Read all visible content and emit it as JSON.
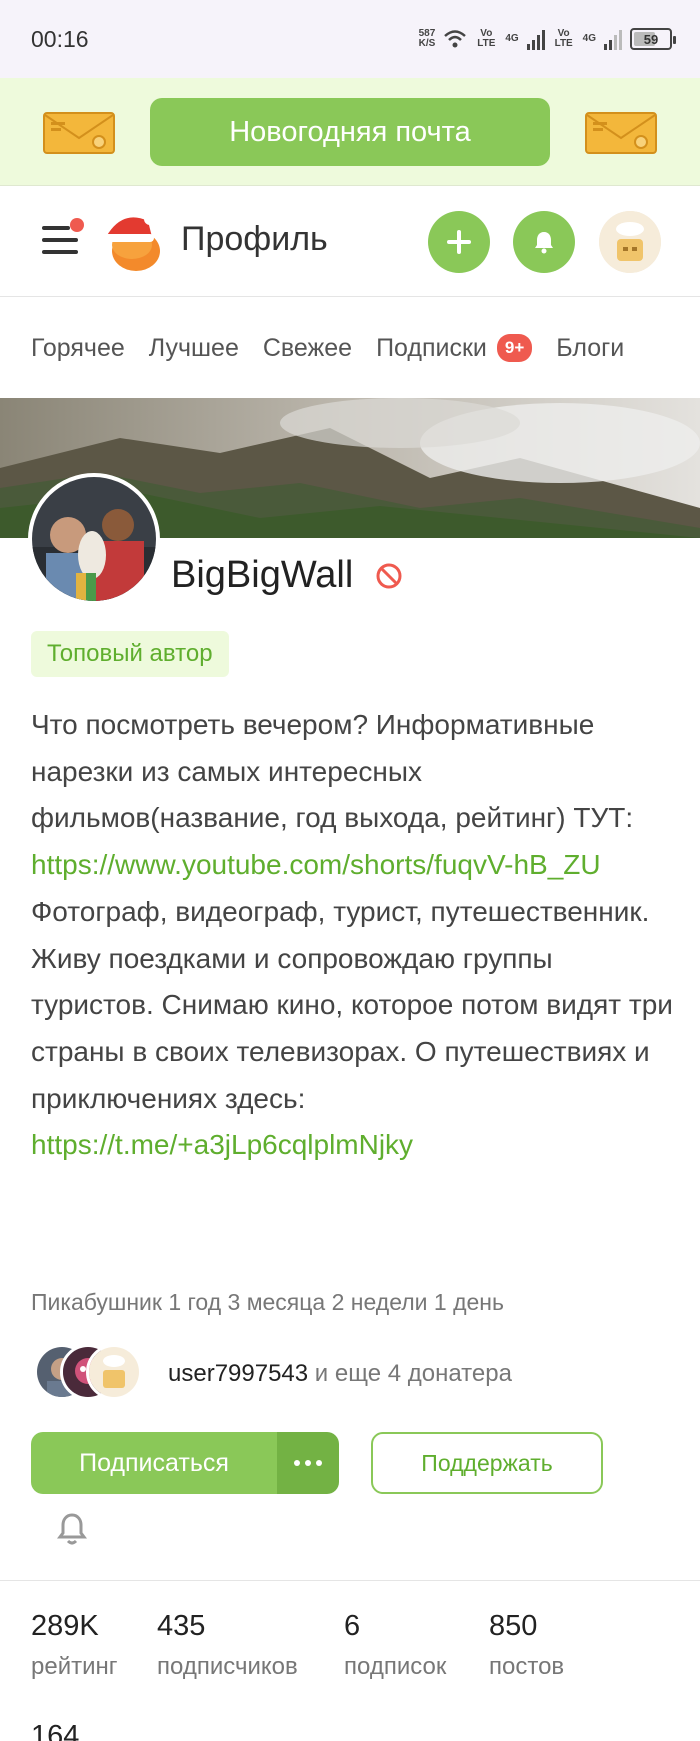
{
  "status_bar": {
    "time": "00:16",
    "net_speed": "587",
    "net_unit": "K/S",
    "volte1": "Vo LTE",
    "sig1": "4G",
    "volte2": "Vo LTE",
    "sig2": "4G",
    "battery": "59"
  },
  "promo": {
    "button_label": "Новогодняя почта",
    "icon_left": "envelope-icon",
    "icon_right": "envelope-icon"
  },
  "header": {
    "title": "Профиль",
    "menu_icon": "menu-icon",
    "add_icon": "plus-icon",
    "bell_icon": "bell-icon"
  },
  "tabs": [
    {
      "label": "Горячее"
    },
    {
      "label": "Лучшее"
    },
    {
      "label": "Свежее"
    },
    {
      "label": "Подписки",
      "badge": "9+"
    },
    {
      "label": "Блоги"
    }
  ],
  "profile": {
    "username": "BigBigWall",
    "tag": "Топовый автор",
    "bio_line1": "Что посмотреть вечером? Информативные нарезки из самых интересных фильмов(название, год выхода, рейтинг) ТУТ: ",
    "bio_link1": "https://www.youtube.com/shorts/fuqvV-hB_ZU",
    "bio_line2": "Фотограф, видеограф, турист, путешественник. Живу поездками и сопровождаю группы туристов. Снимаю кино, которое потом видят три страны в своих телевизорах. О путешествиях и приключениях здесь: ",
    "bio_link2": "https://t.me/+a3jLp6cqlplmNjky",
    "since": "Пикабушник 1 год 3 месяца 2 недели 1 день"
  },
  "donors": {
    "user": "user7997543",
    "rest": " и еще 4 донатера"
  },
  "actions": {
    "subscribe": "Подписаться",
    "support": "Поддержать"
  },
  "stats": [
    {
      "value": "289K",
      "label": "рейтинг"
    },
    {
      "value": "435",
      "label": "подписчиков"
    },
    {
      "value": "6",
      "label": "подписок"
    },
    {
      "value": "850",
      "label": "постов"
    }
  ],
  "stats_extra": "164",
  "colors": {
    "accent": "#8ac858",
    "link": "#5fae2e",
    "badge": "#ef5a4f"
  }
}
